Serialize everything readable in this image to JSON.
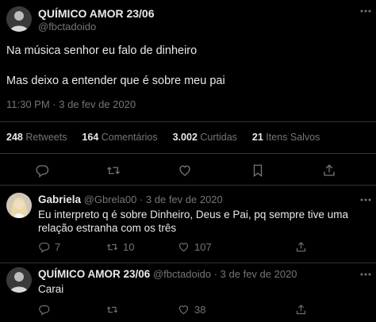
{
  "main_tweet": {
    "display_name": "QUÍMICO AMOR 23/06",
    "handle": "@fbctadoido",
    "line1": "Na música senhor eu falo de dinheiro",
    "line2": "Mas deixo a entender que é sobre meu pai",
    "timestamp": "11:30 PM · 3 de fev de 2020",
    "stats": {
      "retweets_count": "248",
      "retweets_label": "Retweets",
      "comments_count": "164",
      "comments_label": "Comentários",
      "likes_count": "3.002",
      "likes_label": "Curtidas",
      "saves_count": "21",
      "saves_label": "Itens Salvos"
    }
  },
  "reply1": {
    "display_name": "Gabriela",
    "handle": "@Gbrela00",
    "time": "· 3 de fev de 2020",
    "text": "Eu interpreto q é sobre Dinheiro, Deus e Pai, pq sempre tive uma relação estranha com os três",
    "reply_count": "7",
    "retweet_count": "10",
    "like_count": "107"
  },
  "reply2": {
    "display_name": "QUÍMICO AMOR 23/06",
    "handle": "@fbctadoido",
    "time": "· 3 de fev de 2020",
    "text": "Carai",
    "like_count": "38"
  },
  "icons": {
    "more": "more-dots-icon",
    "reply": "reply-icon",
    "retweet": "retweet-icon",
    "like": "heart-icon",
    "bookmark": "bookmark-icon",
    "share": "share-icon"
  },
  "colors": {
    "background": "#000000",
    "text": "#e7e9ea",
    "muted": "#71767b",
    "divider": "#2f3336"
  }
}
